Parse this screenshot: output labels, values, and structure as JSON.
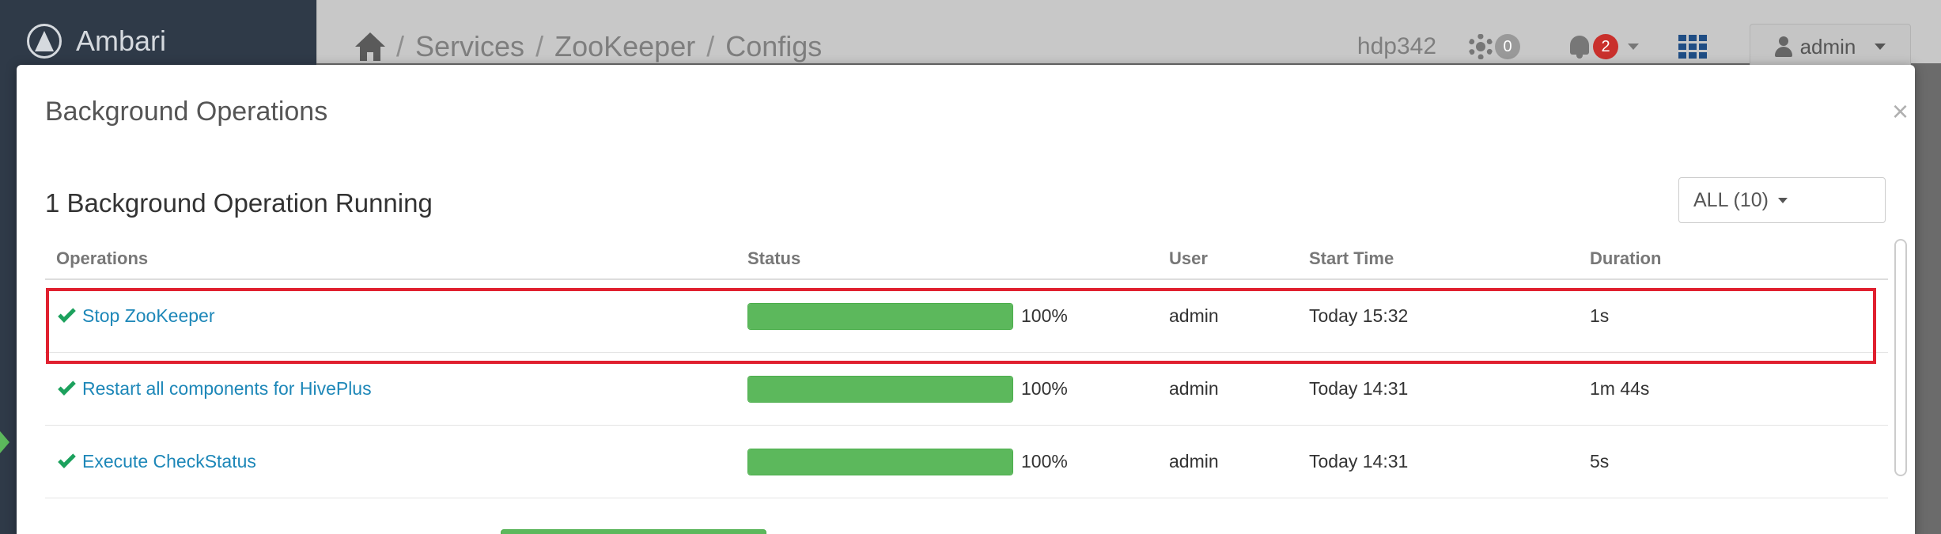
{
  "app": {
    "brand": "Ambari",
    "breadcrumb": [
      "Services",
      "ZooKeeper",
      "Configs"
    ],
    "cluster": "hdp342",
    "ops_count": "0",
    "alerts_count": "2",
    "user": "admin"
  },
  "modal": {
    "title": "Background Operations",
    "close": "×",
    "running_title": "1 Background Operation Running",
    "filter": "ALL (10)",
    "columns": [
      "Operations",
      "Status",
      "User",
      "Start Time",
      "Duration"
    ],
    "rows": [
      {
        "op": "Stop ZooKeeper",
        "progress": 100,
        "pct": "100%",
        "user": "admin",
        "start": "Today 15:32",
        "duration": "1s"
      },
      {
        "op": "Restart all components for HivePlus",
        "progress": 100,
        "pct": "100%",
        "user": "admin",
        "start": "Today 14:31",
        "duration": "1m 44s"
      },
      {
        "op": "Execute CheckStatus",
        "progress": 100,
        "pct": "100%",
        "user": "admin",
        "start": "Today 14:31",
        "duration": "5s"
      }
    ]
  },
  "colors": {
    "highlight": "#e0202f",
    "progress": "#5cb85c",
    "link": "#1d87b8",
    "check": "#1ca15d"
  }
}
